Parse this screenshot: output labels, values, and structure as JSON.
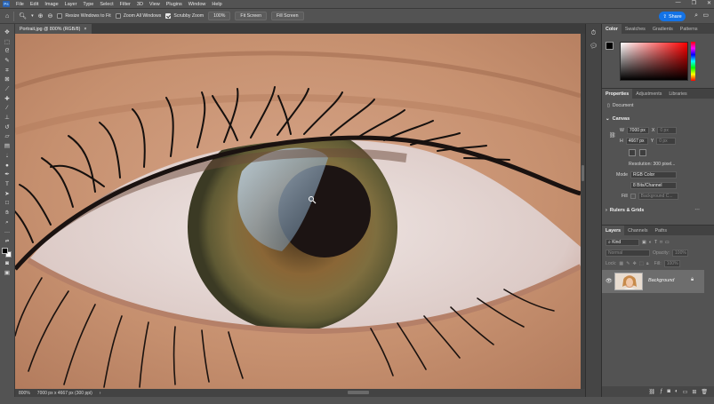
{
  "app": {
    "logo": "Ps"
  },
  "menu": [
    "File",
    "Edit",
    "Image",
    "Layer",
    "Type",
    "Select",
    "Filter",
    "3D",
    "View",
    "Plugins",
    "Window",
    "Help"
  ],
  "window_controls": [
    "—",
    "❐",
    "✕"
  ],
  "options": {
    "resize_windows": "Resize Windows to Fit",
    "zoom_all": "Zoom All Windows",
    "scrubby_zoom": "Scrubby Zoom",
    "zoom_level": "100%",
    "fit_screen": "Fit Screen",
    "fill_screen": "Fill Screen",
    "resize_checked": false,
    "zoom_all_checked": false,
    "scrubby_checked": true
  },
  "share": {
    "label": "Share"
  },
  "document": {
    "tab_title": "Portrait.jpg @ 800% (RGB/8)",
    "close": "×"
  },
  "status": {
    "zoom": "800%",
    "info": "7000 px x 4667 px (300 ppi)",
    "arrow": "›"
  },
  "color_panel": {
    "tabs": [
      "Color",
      "Swatches",
      "Gradients",
      "Patterns"
    ],
    "fg_color": "#000000",
    "bg_color": "#ffffff"
  },
  "properties_panel": {
    "tabs": [
      "Properties",
      "Adjustments",
      "Libraries"
    ],
    "doc_label": "Document",
    "canvas_section": "Canvas",
    "w_label": "W",
    "w_value": "7000 px",
    "h_label": "H",
    "h_value": "4667 px",
    "x_label": "X",
    "x_value": "0 px",
    "y_label": "Y",
    "y_value": "0 px",
    "resolution": "Resolution: 300 pixel...",
    "mode_label": "Mode",
    "mode_value": "RGB Color",
    "bits_value": "8 Bits/Channel",
    "fill_label": "Fill",
    "fill_value": "Background C...",
    "rulers_section": "Rulers & Grids"
  },
  "layers_panel": {
    "tabs": [
      "Layers",
      "Channels",
      "Paths"
    ],
    "filter_kind": "Kind",
    "blend_mode": "Normal",
    "opacity_label": "Opacity:",
    "opacity_value": "100%",
    "lock_label": "Lock:",
    "fill_label": "Fill:",
    "fill_value": "100%",
    "layer_name": "Background"
  },
  "icons": {
    "tools": [
      "move-icon",
      "artboard-icon",
      "lasso-icon",
      "quick-select-icon",
      "crop-icon",
      "frame-icon",
      "eyedropper-icon",
      "healing-icon",
      "brush-icon",
      "clone-stamp-icon",
      "history-brush-icon",
      "eraser-icon",
      "gradient-icon",
      "blur-icon",
      "dodge-icon",
      "pen-icon",
      "type-icon",
      "path-select-icon",
      "rectangle-icon",
      "hand-icon",
      "zoom-icon",
      "more-icon"
    ]
  }
}
